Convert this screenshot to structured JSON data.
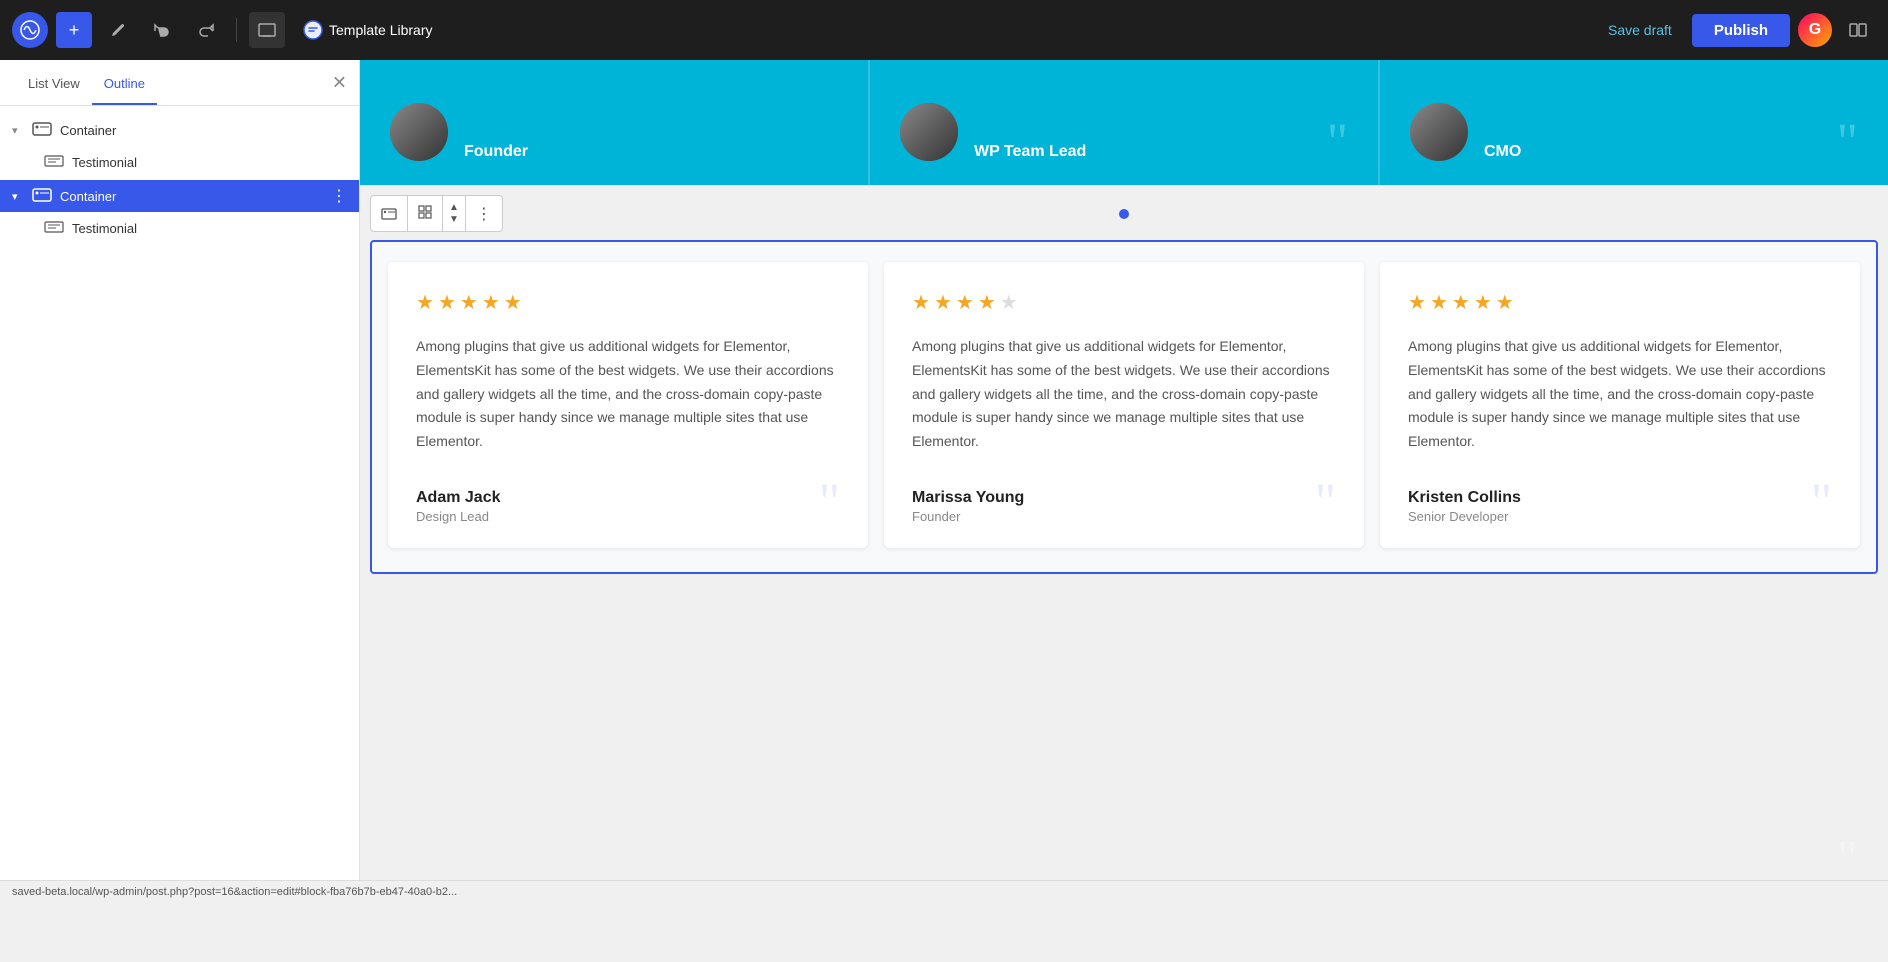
{
  "topbar": {
    "wp_logo": "W",
    "add_label": "+",
    "template_library_label": "Template Library",
    "save_draft_label": "Save draft",
    "publish_label": "Publish"
  },
  "sidebar": {
    "tab_list_view": "List View",
    "tab_outline": "Outline",
    "active_tab": "outline",
    "tree": [
      {
        "id": "container-1",
        "label": "Container",
        "type": "container",
        "expanded": true,
        "children": [
          {
            "id": "testimonial-1",
            "label": "Testimonial",
            "type": "testimonial"
          }
        ]
      },
      {
        "id": "container-2",
        "label": "Container",
        "type": "container",
        "expanded": true,
        "active": true,
        "children": [
          {
            "id": "testimonial-2",
            "label": "Testimonial",
            "type": "testimonial"
          }
        ]
      }
    ]
  },
  "top_cards": [
    {
      "name": "Founder",
      "role": "Founder"
    },
    {
      "name": "WP Team Lead",
      "role": "WP Team Lead"
    },
    {
      "name": "CMO",
      "role": "CMO"
    }
  ],
  "testimonials": [
    {
      "stars": 5,
      "text": "Among plugins that give us additional widgets for Elementor, ElementsKit has some of the best widgets. We use their accordions and gallery widgets all the time, and the cross-domain copy-paste module is super handy since we manage multiple sites that use Elementor.",
      "author_name": "Adam Jack",
      "author_role": "Design Lead"
    },
    {
      "stars": 4,
      "text": "Among plugins that give us additional widgets for Elementor, ElementsKit has some of the best widgets. We use their accordions and gallery widgets all the time, and the cross-domain copy-paste module is super handy since we manage multiple sites that use Elementor.",
      "author_name": "Marissa Young",
      "author_role": "Founder"
    },
    {
      "stars": 5,
      "text": "Among plugins that give us additional widgets for Elementor, ElementsKit has some of the best widgets. We use their accordions and gallery widgets all the time, and the cross-domain copy-paste module is super handy since we manage multiple sites that use Elementor.",
      "author_name": "Kristen Collins",
      "author_role": "Senior Developer"
    }
  ],
  "statusbar": {
    "url": "saved-beta.local/wp-admin/post.php?post=16&action=edit#block-fba76b7b-eb47-40a0-b2..."
  },
  "colors": {
    "blue": "#3858e9",
    "cyan": "#00b4d8",
    "star": "#f5a623"
  }
}
